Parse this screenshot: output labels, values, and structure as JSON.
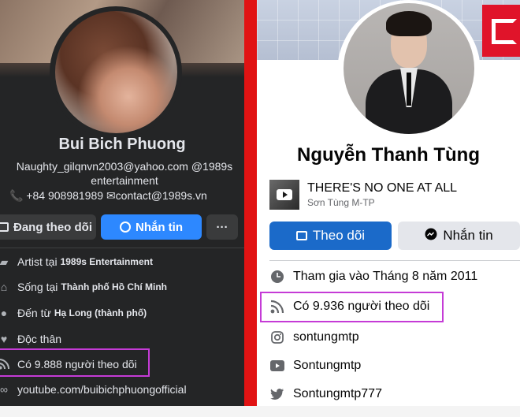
{
  "left_profile": {
    "name": "Bui Bich Phuong",
    "bio_line1": "Naughty_gilqnvn2003@yahoo.com @1989s",
    "bio_line2": "entertainment",
    "phone": "+84 908981989",
    "email": "contact@1989s.vn",
    "buttons": {
      "following": "Đang theo dõi",
      "message": "Nhắn tin",
      "more": "···"
    },
    "details": [
      {
        "prefix": "Artist tại",
        "value": "1989s Entertainment",
        "icon": "briefcase-icon"
      },
      {
        "prefix": "Sống tại",
        "value": "Thành phố Hồ Chí Minh",
        "icon": "home-icon"
      },
      {
        "prefix": "Đến từ",
        "value": "Hạ Long (thành phố)",
        "icon": "location-pin-icon"
      },
      {
        "prefix": "Độc thân",
        "value": "",
        "icon": "heart-icon"
      },
      {
        "prefix": "Có 9.888 người theo dõi",
        "value": "",
        "icon": "rss-icon"
      },
      {
        "prefix": "youtube.com/buibichphuongofficial",
        "value": "",
        "icon": "link-icon"
      }
    ],
    "colors": {
      "background": "#242526",
      "message_button": "#2d88ff",
      "highlight": "#c53bd6"
    }
  },
  "right_profile": {
    "name": "Nguyễn Thanh Tùng",
    "song": {
      "title": "THERE'S NO ONE AT ALL",
      "artist": "Sơn Tùng M-TP"
    },
    "buttons": {
      "follow": "Theo dõi",
      "message": "Nhắn tin"
    },
    "details": [
      {
        "text": "Tham gia vào Tháng 8 năm 2011",
        "icon": "clock-icon"
      },
      {
        "text": "Có 9.936 người theo dõi",
        "icon": "rss-icon"
      },
      {
        "text": "sontungmtp",
        "icon": "instagram-icon"
      },
      {
        "text": "Sontungmtp",
        "icon": "youtube-icon"
      },
      {
        "text": "Sontungmtp777",
        "icon": "twitter-icon"
      }
    ],
    "colors": {
      "background": "#ffffff",
      "follow_button": "#1b6ac9",
      "highlight": "#c53bd6"
    }
  },
  "divider_color": "#e11313"
}
